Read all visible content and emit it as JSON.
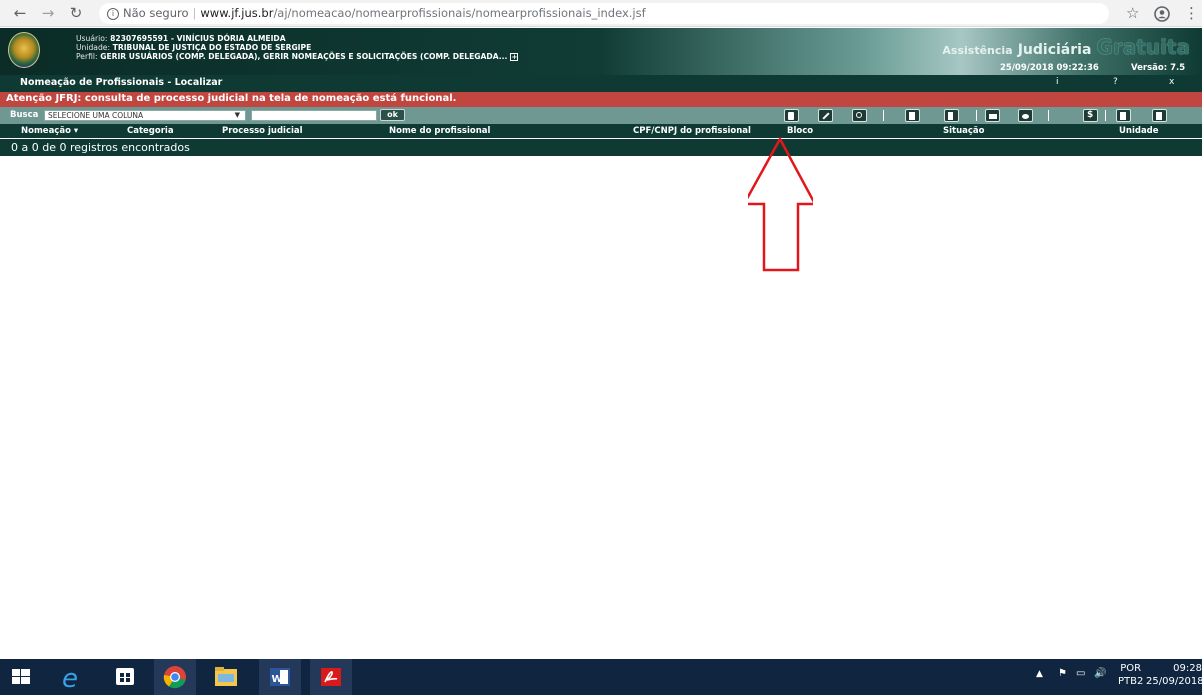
{
  "browser": {
    "back_icon": "back-arrow-icon",
    "forward_icon": "forward-arrow-icon",
    "reload_icon": "reload-icon",
    "security_label": "Não seguro",
    "url_domain": "www.jf.jus.br",
    "url_path": "/aj/nomeacao/nomearprofissionais/nomearprofissionais_index.jsf",
    "star_icon": "star-icon",
    "profile_icon": "profile-icon",
    "menu_icon": "more-vert-icon"
  },
  "app_header": {
    "user_label": "Usuário:",
    "user_value": "82307695591 - VINÍCIUS DÓRIA ALMEIDA",
    "unit_label": "Unidade:",
    "unit_value": "TRIBUNAL DE JUSTIÇA DO ESTADO DE SERGIPE",
    "profile_label": "Perfil:",
    "profile_value": "GERIR USUÁRIOS (COMP. DELEGADA), GERIR NOMEAÇÕES E SOLICITAÇÕES (COMP. DELEGADA...",
    "brand_small": "Assistência",
    "brand_mid": "Judiciária",
    "brand_big": "Gratuita",
    "datetime": "25/09/2018 09:22:36",
    "version": "Versão: 7.5"
  },
  "title_bar": {
    "title": "Nomeação de Profissionais - Localizar",
    "info": "i",
    "help": "?",
    "close": "x"
  },
  "alert": {
    "text": "Atenção JFRJ: consulta de processo judicial na tela de nomeação está funcional."
  },
  "search": {
    "label": "Busca",
    "select_value": "SELECIONE UMA COLUNA",
    "input_value": "",
    "ok_label": "ok"
  },
  "toolbar_icons": [
    "new-icon",
    "edit-icon",
    "search-icon",
    "document-icon",
    "copy-icon",
    "print-icon",
    "view-icon",
    "money-icon",
    "report-icon",
    "export-icon"
  ],
  "table": {
    "columns": [
      "Nomeação ▾",
      "Categoria",
      "Processo judicial",
      "Nome do profissional",
      "CPF/CNPJ do profissional",
      "Bloco",
      "Situação",
      "Unidade"
    ],
    "records": "0 a 0 de 0 registros encontrados"
  },
  "taskbar": {
    "apps": [
      "windows-start-icon",
      "internet-explorer-icon",
      "store-icon",
      "chrome-icon",
      "file-explorer-icon",
      "word-icon",
      "acrobat-icon"
    ],
    "lang": "POR",
    "layout": "PTB2",
    "time": "09:28",
    "date": "25/09/2018"
  },
  "colors": {
    "header_dark": "#0f3a33",
    "alert_red": "#c24640",
    "search_bar": "#6f9892",
    "annotation_red": "#e2171b"
  }
}
